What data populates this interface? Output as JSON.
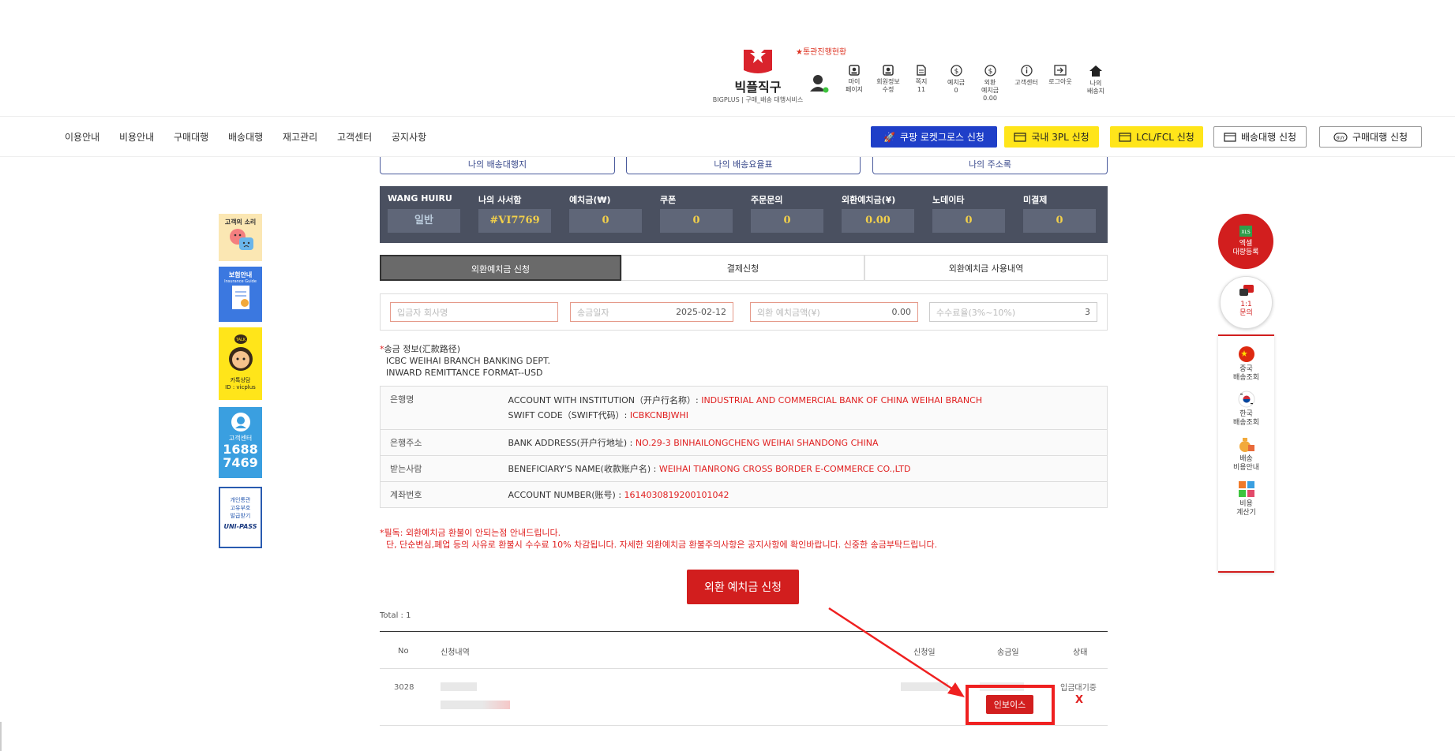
{
  "header": {
    "brand": "빅플직구",
    "brand_sub": "BIGPLUS | 구매_배송 대행서비스",
    "tracking_link": "★통관진행현황",
    "icons": [
      {
        "label": "마이\n페이지",
        "icon": "my-page-icon"
      },
      {
        "label": "회원정보\n수정",
        "icon": "member-edit-icon"
      },
      {
        "label": "쪽지\n11",
        "icon": "message-icon"
      },
      {
        "label": "예치금\n0",
        "icon": "deposit-icon"
      },
      {
        "label": "외환\n예치금\n0.00",
        "icon": "fx-deposit-icon"
      },
      {
        "label": "고객센터",
        "icon": "info-icon"
      },
      {
        "label": "로그아웃",
        "icon": "logout-icon"
      },
      {
        "label": "나의\n배송지",
        "icon": "home-icon"
      }
    ]
  },
  "nav": {
    "items": [
      "이용안내",
      "비용안내",
      "구매대행",
      "배송대행",
      "재고관리",
      "고객센터",
      "공지사항"
    ],
    "buttons": [
      "쿠팡 로켓그로스 신청",
      "국내 3PL 신청",
      "LCL/FCL 신청",
      "배송대행 신청",
      "구매대행 신청"
    ]
  },
  "left_banners": {
    "voice": "고객의 소리",
    "insurance": "보험안내",
    "insurance_sub": "Insurance Guide",
    "kakao": "카톡상담",
    "kakao_id": "ID : vicplus",
    "kakao_badge": "TALK",
    "cs": "고객센터",
    "cs_num1": "1688",
    "cs_num2": "7469",
    "unipass1": "개인통관",
    "unipass2": "고유부호",
    "unipass3": "발급받기",
    "unipass_logo": "UNI-PASS"
  },
  "right_float": {
    "excel": "엑셀\n대량등록",
    "excel_badge": "XLS",
    "inquiry": "1:1\n문의",
    "china": "중국\n배송조회",
    "korea": "한국\n배송조회",
    "shipping_cost": "배송\n비용안내",
    "calculator": "비용\n계산기"
  },
  "main": {
    "quick_tabs": [
      "나의 배송대행지",
      "나의 배송요율표",
      "나의 주소록"
    ],
    "stats": [
      {
        "label": "WANG HUIRU",
        "value": "일반"
      },
      {
        "label": "나의 사서함",
        "value": "#VI7769"
      },
      {
        "label": "예치금(₩)",
        "value": "0"
      },
      {
        "label": "쿠폰",
        "value": "0"
      },
      {
        "label": "주문문의",
        "value": "0"
      },
      {
        "label": "외환예치금(¥)",
        "value": "0.00"
      },
      {
        "label": "노데이타",
        "value": "0"
      },
      {
        "label": "미결제",
        "value": "0"
      }
    ],
    "deposit_tabs": [
      "외환예치금 신청",
      "결제신청",
      "외환예치금 사용내역"
    ],
    "form": {
      "depositor_placeholder": "입금자 회사명",
      "date_label": "송금일자",
      "date_value": "2025-02-12",
      "amount_label": "외환 예치금액(¥)",
      "amount_value": "0.00",
      "fee_label": "수수료율(3%~10%)",
      "fee_value": "3"
    },
    "remit_title": "송금 정보(汇款路径)",
    "remit_line1": "ICBC WEIHAI BRANCH BANKING DEPT.",
    "remit_line2": "INWARD REMITTANCE FORMAT--USD",
    "bank": {
      "name_label": "은행명",
      "name_key": "ACCOUNT WITH INSTITUTION（开户行名称）: ",
      "name_val": "INDUSTRIAL AND COMMERCIAL BANK OF CHINA WEIHAI BRANCH",
      "swift_key": "SWIFT CODE（SWIFT代码）: ",
      "swift_val": "ICBKCNBJWHI",
      "addr_label": "은행주소",
      "addr_key": "BANK ADDRESS(开户行地址) : ",
      "addr_val": "NO.29-3 BINHAILONGCHENG WEIHAI SHANDONG CHINA",
      "bene_label": "받는사람",
      "bene_key": "BENEFICIARY'S NAME(收款账户名) : ",
      "bene_val": "WEIHAI TIANRONG CROSS BORDER E-COMMERCE CO.,LTD",
      "acct_label": "계좌번호",
      "acct_key": "ACCOUNT NUMBER(账号) : ",
      "acct_val": "1614030819200101042"
    },
    "notice1": "*필독: 외환예치금 환불이 안되는점 안내드립니다.",
    "notice2": "단, 단순변심,폐업 등의 사유로 환불시 수수료 10% 차감됩니다. 자세한 외환예치금 환불주의사항은 공지사항에 확인바랍니다. 신중한 송금부탁드립니다.",
    "apply_button": "외환 예치금 신청",
    "total": "Total : 1",
    "list_headers": {
      "no": "No",
      "detail": "신청내역",
      "apply_date": "신청일",
      "remit_date": "송금일",
      "status": "상태"
    },
    "row": {
      "no": "3028",
      "status": "입금대기중",
      "invoice": "인보이스",
      "delete": "X"
    }
  }
}
